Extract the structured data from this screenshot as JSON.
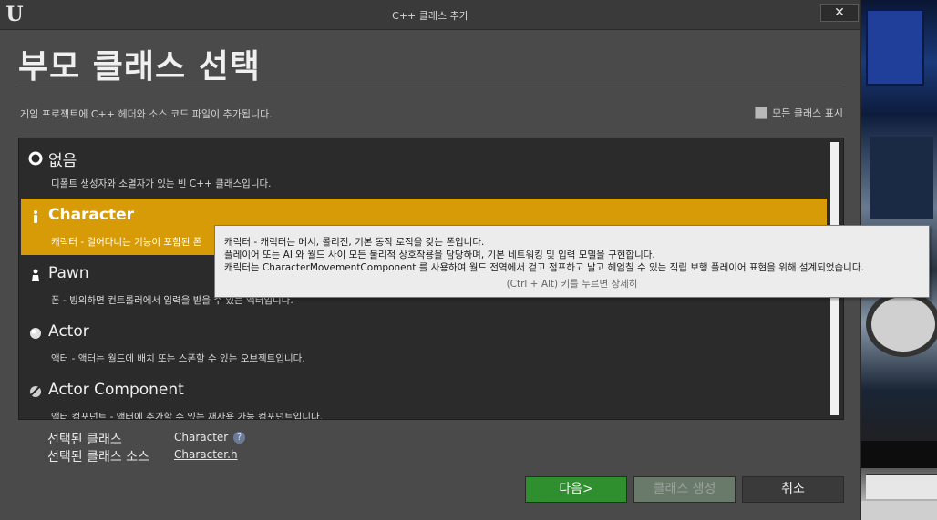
{
  "window": {
    "title": "C++ 클래스 추가",
    "close_label": "✕",
    "logo_text": "U"
  },
  "header": {
    "title": "부모 클래스 선택",
    "subtitle": "게임 프로젝트에 C++ 헤더와 소스 코드 파일이 추가됩니다.",
    "show_all_label": "모든 클래스 표시",
    "show_all_checked": false
  },
  "class_list": {
    "items": [
      {
        "name": "없음",
        "desc": "디폴트 생성자와 소멸자가 있는 빈 C++ 클래스입니다.",
        "icon": "none-radio-icon",
        "selected": false
      },
      {
        "name": "Character",
        "desc": "캐릭터 - 걸어다니는 기능이 포함된 폰",
        "icon": "character-icon",
        "selected": true
      },
      {
        "name": "Pawn",
        "desc": "폰 - 빙의하면 컨트롤러에서 입력을 받을 수 있는 액터입니다.",
        "icon": "pawn-icon",
        "selected": false
      },
      {
        "name": "Actor",
        "desc": "액터 - 액터는 월드에 배치 또는 스폰할 수 있는 오브젝트입니다.",
        "icon": "actor-icon",
        "selected": false
      },
      {
        "name": "Actor Component",
        "desc": "액터 컴포넌트 - 액터에 추가할 수 있는 재사용 가능 컴포넌트입니다.",
        "icon": "actor-component-icon",
        "selected": false
      }
    ]
  },
  "tooltip": {
    "line1": "캐릭터 - 캐릭터는 메시, 콜리전, 기본 동작 로직을 갖는 폰입니다.",
    "line2": "플레이어 또는 AI 와 월드 사이 모든 물리적 상호작용을 담당하며, 기본 네트워킹 및 입력 모델을 구현합니다.",
    "line3": "캐릭터는 CharacterMovementComponent 를 사용하여 월드 전역에서 걷고 점프하고 날고 헤엄칠 수 있는 직립 보행 플레이어 표현을 위해 설계되었습니다.",
    "hint": "(Ctrl + Alt) 키를 누르면 상세히"
  },
  "selection": {
    "class_label": "선택된 클래스",
    "class_value": "Character",
    "source_label": "선택된 클래스 소스",
    "source_value": "Character.h",
    "help_symbol": "?"
  },
  "buttons": {
    "next": "다음>",
    "create": "클래스 생성",
    "cancel": "취소"
  },
  "colors": {
    "selected_row": "#d79b08",
    "next_button": "#2f8f2f",
    "window_bg": "#4a4a4a",
    "list_bg": "#2b2b2b"
  }
}
